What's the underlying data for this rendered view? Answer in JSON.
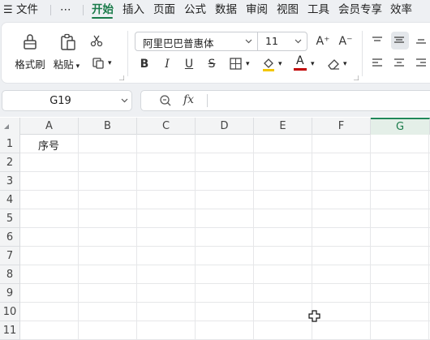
{
  "menu": {
    "hamburger_icon": "hamburger-icon",
    "file": "文件",
    "more": "⋯",
    "tabs": [
      "开始",
      "插入",
      "页面",
      "公式",
      "数据",
      "审阅",
      "视图",
      "工具",
      "会员专享",
      "效率"
    ],
    "active_tab": "开始"
  },
  "ribbon": {
    "format_painter": "格式刷",
    "paste": "粘贴",
    "font_name": "阿里巴巴普惠体",
    "font_size": "11",
    "bold": "B",
    "italic": "I",
    "underline": "U",
    "strikethrough": "S",
    "font_color_letter": "A",
    "font_color": "#c00000",
    "fill_color": "#f3c600",
    "increase_font": "A⁺",
    "decrease_font": "A⁻"
  },
  "formula_bar": {
    "name_box": "G19",
    "fx": "fx",
    "formula": ""
  },
  "sheet": {
    "columns": [
      "A",
      "B",
      "C",
      "D",
      "E",
      "F",
      "G"
    ],
    "selected_column": "G",
    "rows": [
      "1",
      "2",
      "3",
      "4",
      "5",
      "6",
      "7",
      "8",
      "9",
      "10",
      "11"
    ],
    "cells": {
      "A1": "序号"
    }
  },
  "colors": {
    "accent": "#1a7b4a"
  }
}
